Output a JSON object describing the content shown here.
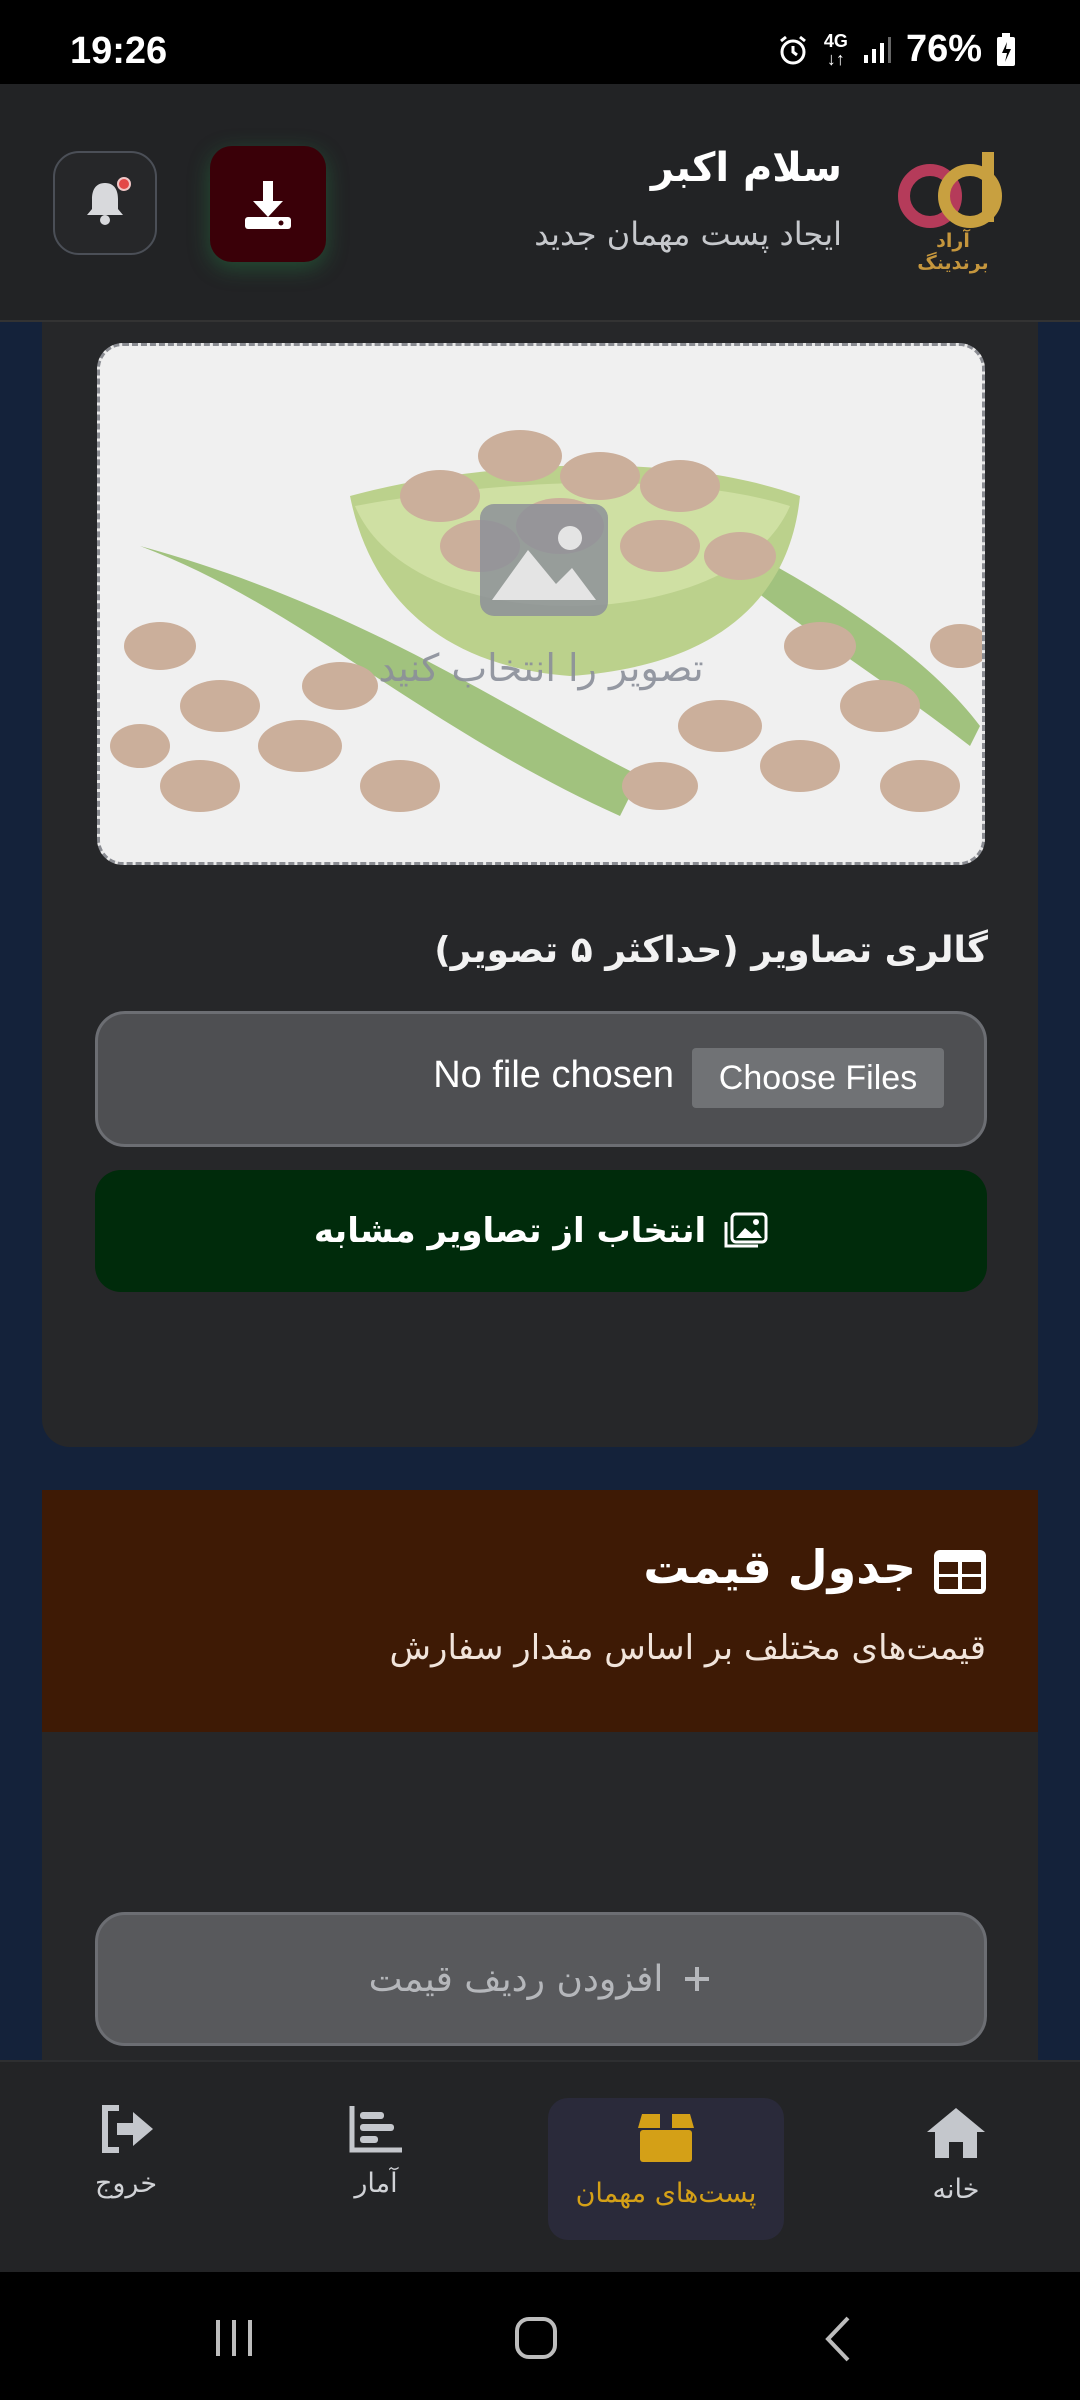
{
  "status_bar": {
    "time": "19:26",
    "network": "4G",
    "battery": "76%"
  },
  "header": {
    "greeting": "سلام اکبر",
    "subtitle": "ایجاد پست مهمان جدید",
    "logo_text": "آراد برندینگ"
  },
  "main_image": {
    "placeholder": "تصویر را انتخاب کنید"
  },
  "gallery": {
    "label": "گالری تصاویر (حداکثر ۵ تصویر)",
    "choose_button": "Choose Files",
    "no_file_text": "No file chosen",
    "similar_button": "انتخاب از تصاویر مشابه"
  },
  "price_table": {
    "title": "جدول قیمت",
    "subtitle": "قیمت‌های مختلف بر اساس مقدار سفارش",
    "add_row_button": "افزودن ردیف قیمت"
  },
  "bottom_nav": {
    "home": "خانه",
    "guest_posts": "پست‌های مهمان",
    "stats": "آمار",
    "logout": "خروج"
  },
  "colors": {
    "accent": "#d4a017",
    "download_bg": "#3a0008",
    "similar_bg": "#002b0b",
    "price_header_bg": "#3e1a05"
  }
}
